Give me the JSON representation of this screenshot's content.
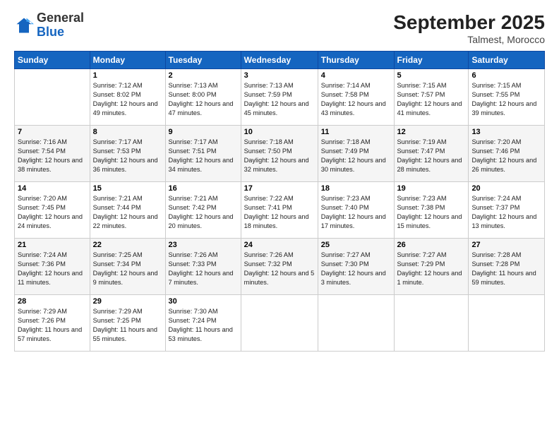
{
  "header": {
    "logo": {
      "general": "General",
      "blue": "Blue"
    },
    "title": "September 2025",
    "subtitle": "Talmest, Morocco"
  },
  "days_of_week": [
    "Sunday",
    "Monday",
    "Tuesday",
    "Wednesday",
    "Thursday",
    "Friday",
    "Saturday"
  ],
  "weeks": [
    [
      {
        "day": "",
        "info": ""
      },
      {
        "day": "1",
        "info": "Sunrise: 7:12 AM\nSunset: 8:02 PM\nDaylight: 12 hours and 49 minutes."
      },
      {
        "day": "2",
        "info": "Sunrise: 7:13 AM\nSunset: 8:00 PM\nDaylight: 12 hours and 47 minutes."
      },
      {
        "day": "3",
        "info": "Sunrise: 7:13 AM\nSunset: 7:59 PM\nDaylight: 12 hours and 45 minutes."
      },
      {
        "day": "4",
        "info": "Sunrise: 7:14 AM\nSunset: 7:58 PM\nDaylight: 12 hours and 43 minutes."
      },
      {
        "day": "5",
        "info": "Sunrise: 7:15 AM\nSunset: 7:57 PM\nDaylight: 12 hours and 41 minutes."
      },
      {
        "day": "6",
        "info": "Sunrise: 7:15 AM\nSunset: 7:55 PM\nDaylight: 12 hours and 39 minutes."
      }
    ],
    [
      {
        "day": "7",
        "info": "Sunrise: 7:16 AM\nSunset: 7:54 PM\nDaylight: 12 hours and 38 minutes."
      },
      {
        "day": "8",
        "info": "Sunrise: 7:17 AM\nSunset: 7:53 PM\nDaylight: 12 hours and 36 minutes."
      },
      {
        "day": "9",
        "info": "Sunrise: 7:17 AM\nSunset: 7:51 PM\nDaylight: 12 hours and 34 minutes."
      },
      {
        "day": "10",
        "info": "Sunrise: 7:18 AM\nSunset: 7:50 PM\nDaylight: 12 hours and 32 minutes."
      },
      {
        "day": "11",
        "info": "Sunrise: 7:18 AM\nSunset: 7:49 PM\nDaylight: 12 hours and 30 minutes."
      },
      {
        "day": "12",
        "info": "Sunrise: 7:19 AM\nSunset: 7:47 PM\nDaylight: 12 hours and 28 minutes."
      },
      {
        "day": "13",
        "info": "Sunrise: 7:20 AM\nSunset: 7:46 PM\nDaylight: 12 hours and 26 minutes."
      }
    ],
    [
      {
        "day": "14",
        "info": "Sunrise: 7:20 AM\nSunset: 7:45 PM\nDaylight: 12 hours and 24 minutes."
      },
      {
        "day": "15",
        "info": "Sunrise: 7:21 AM\nSunset: 7:44 PM\nDaylight: 12 hours and 22 minutes."
      },
      {
        "day": "16",
        "info": "Sunrise: 7:21 AM\nSunset: 7:42 PM\nDaylight: 12 hours and 20 minutes."
      },
      {
        "day": "17",
        "info": "Sunrise: 7:22 AM\nSunset: 7:41 PM\nDaylight: 12 hours and 18 minutes."
      },
      {
        "day": "18",
        "info": "Sunrise: 7:23 AM\nSunset: 7:40 PM\nDaylight: 12 hours and 17 minutes."
      },
      {
        "day": "19",
        "info": "Sunrise: 7:23 AM\nSunset: 7:38 PM\nDaylight: 12 hours and 15 minutes."
      },
      {
        "day": "20",
        "info": "Sunrise: 7:24 AM\nSunset: 7:37 PM\nDaylight: 12 hours and 13 minutes."
      }
    ],
    [
      {
        "day": "21",
        "info": "Sunrise: 7:24 AM\nSunset: 7:36 PM\nDaylight: 12 hours and 11 minutes."
      },
      {
        "day": "22",
        "info": "Sunrise: 7:25 AM\nSunset: 7:34 PM\nDaylight: 12 hours and 9 minutes."
      },
      {
        "day": "23",
        "info": "Sunrise: 7:26 AM\nSunset: 7:33 PM\nDaylight: 12 hours and 7 minutes."
      },
      {
        "day": "24",
        "info": "Sunrise: 7:26 AM\nSunset: 7:32 PM\nDaylight: 12 hours and 5 minutes."
      },
      {
        "day": "25",
        "info": "Sunrise: 7:27 AM\nSunset: 7:30 PM\nDaylight: 12 hours and 3 minutes."
      },
      {
        "day": "26",
        "info": "Sunrise: 7:27 AM\nSunset: 7:29 PM\nDaylight: 12 hours and 1 minute."
      },
      {
        "day": "27",
        "info": "Sunrise: 7:28 AM\nSunset: 7:28 PM\nDaylight: 11 hours and 59 minutes."
      }
    ],
    [
      {
        "day": "28",
        "info": "Sunrise: 7:29 AM\nSunset: 7:26 PM\nDaylight: 11 hours and 57 minutes."
      },
      {
        "day": "29",
        "info": "Sunrise: 7:29 AM\nSunset: 7:25 PM\nDaylight: 11 hours and 55 minutes."
      },
      {
        "day": "30",
        "info": "Sunrise: 7:30 AM\nSunset: 7:24 PM\nDaylight: 11 hours and 53 minutes."
      },
      {
        "day": "",
        "info": ""
      },
      {
        "day": "",
        "info": ""
      },
      {
        "day": "",
        "info": ""
      },
      {
        "day": "",
        "info": ""
      }
    ]
  ]
}
